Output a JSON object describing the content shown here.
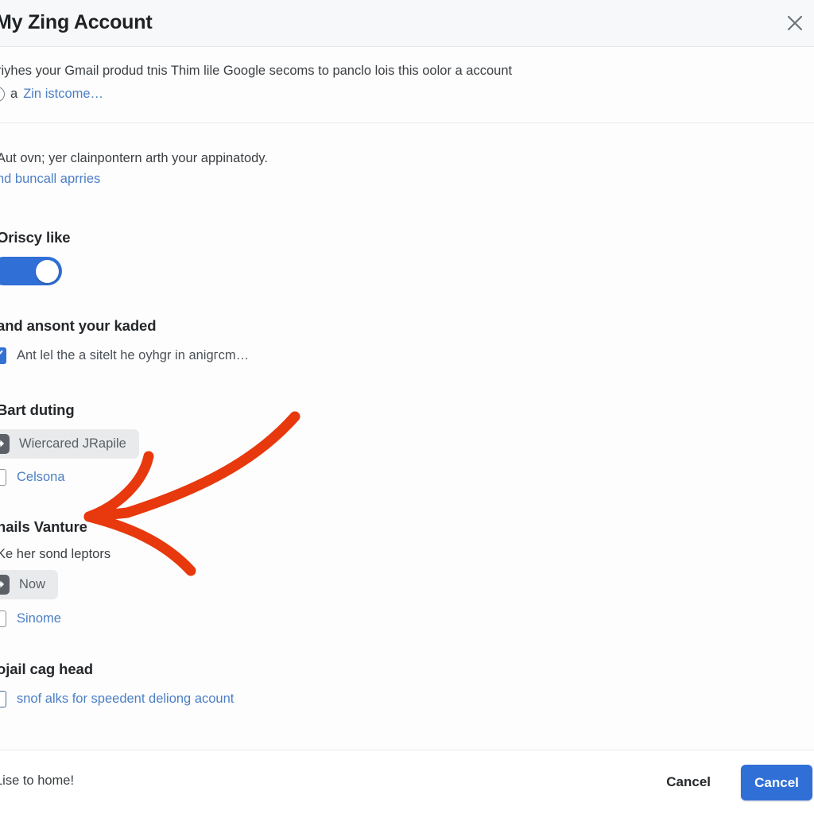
{
  "dialog": {
    "title": "My Zing Account",
    "close_icon": "close-icon"
  },
  "intro": {
    "line1": "riyhes your Gmail produd tnis Thim lile Google secoms to panclo lois this oolor a account",
    "prefix": "a",
    "link": "Zin istcome…"
  },
  "sections": {
    "auto": {
      "text": "Aut ovn; yer clainpontern arth your appinatody.",
      "link": "nd buncall aprries"
    },
    "privacy": {
      "title": "Oriscy like",
      "toggle_on": true
    },
    "consent": {
      "title": "and ansont your kaded",
      "checkbox_label": "Ant lel the a sitelt he oуhgr in aniɡгcm…",
      "checkbox_checked": true
    },
    "start": {
      "title": "Bart duting",
      "chip_label": "Wiercared JRapile",
      "chip_icon": "share-arrow-icon",
      "checkbox_label": "Celsona",
      "checkbox_checked": false
    },
    "mails": {
      "title": "hails Vanture",
      "text": "Ke her sond leptors",
      "chip_label": "Now",
      "chip_icon": "share-arrow-icon",
      "checkbox_label": "Sinome",
      "checkbox_checked": false
    },
    "social": {
      "title": "ojail cag head",
      "checkbox_label": "snof alks for speedent deliong acount",
      "checkbox_checked": false
    }
  },
  "footer": {
    "note": "Lise to home!",
    "secondary_label": "Cancel",
    "primary_label": "Cancel"
  },
  "colors": {
    "accent_blue": "#2f6fd6",
    "link_blue": "#4c7fc4",
    "checkbox_blue": "#3370d4",
    "annotation_red": "#e8380d",
    "header_bg": "#f7f8f9",
    "chip_bg": "#e9eaec"
  },
  "annotation": {
    "type": "hand-drawn-arrow",
    "color": "#e8380d",
    "points_to": "mails Vanture section"
  }
}
